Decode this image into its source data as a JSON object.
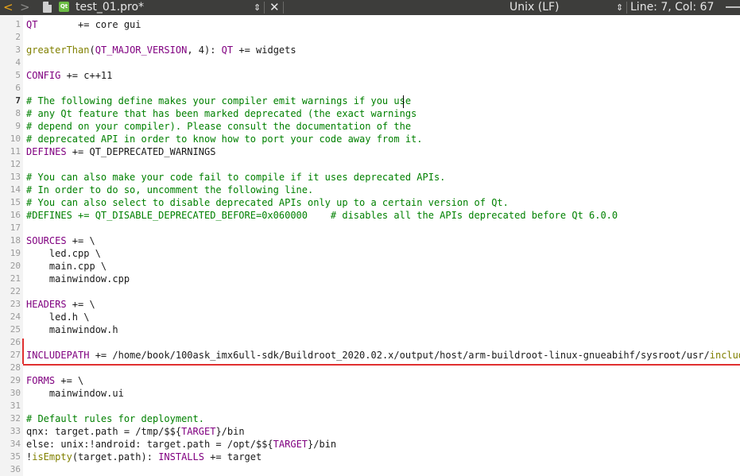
{
  "toolbar": {
    "back_glyph": "<",
    "forward_glyph": ">",
    "file_badge": "Qt",
    "file_name": "test_01.pro*",
    "updown_glyph": "⇕",
    "close_glyph": "✕",
    "line_ending": "Unix (LF)",
    "line_ending_arrow": "⇕",
    "position": "Line: 7, Col: 67"
  },
  "editor": {
    "current_line": 7,
    "lines": [
      [
        {
          "t": "QT",
          "c": "var"
        },
        {
          "t": "       += core gui",
          "c": "plain"
        }
      ],
      [],
      [
        {
          "t": "greaterThan",
          "c": "fn"
        },
        {
          "t": "(",
          "c": "plain"
        },
        {
          "t": "QT_MAJOR_VERSION",
          "c": "var"
        },
        {
          "t": ", 4): ",
          "c": "plain"
        },
        {
          "t": "QT",
          "c": "var"
        },
        {
          "t": " += widgets",
          "c": "plain"
        }
      ],
      [],
      [
        {
          "t": "CONFIG",
          "c": "var"
        },
        {
          "t": " += c++11",
          "c": "plain"
        }
      ],
      [],
      [
        {
          "t": "# The following define makes your compiler emit warnings if you use",
          "c": "cm"
        }
      ],
      [
        {
          "t": "# any Qt feature that has been marked deprecated (the exact warnings",
          "c": "cm"
        }
      ],
      [
        {
          "t": "# depend on your compiler). Please consult the documentation of the",
          "c": "cm"
        }
      ],
      [
        {
          "t": "# deprecated API in order to know how to port your code away from it.",
          "c": "cm"
        }
      ],
      [
        {
          "t": "DEFINES",
          "c": "var"
        },
        {
          "t": " += QT_DEPRECATED_WARNINGS",
          "c": "plain"
        }
      ],
      [],
      [
        {
          "t": "# You can also make your code fail to compile if it uses deprecated APIs.",
          "c": "cm"
        }
      ],
      [
        {
          "t": "# In order to do so, uncomment the following line.",
          "c": "cm"
        }
      ],
      [
        {
          "t": "# You can also select to disable deprecated APIs only up to a certain version of Qt.",
          "c": "cm"
        }
      ],
      [
        {
          "t": "#DEFINES += QT_DISABLE_DEPRECATED_BEFORE=0x060000    # disables all the APIs deprecated before Qt 6.0.0",
          "c": "cm"
        }
      ],
      [],
      [
        {
          "t": "SOURCES",
          "c": "var"
        },
        {
          "t": " += \\",
          "c": "plain"
        }
      ],
      [
        {
          "t": "    led.cpp \\",
          "c": "plain"
        }
      ],
      [
        {
          "t": "    main.cpp \\",
          "c": "plain"
        }
      ],
      [
        {
          "t": "    mainwindow.cpp",
          "c": "plain"
        }
      ],
      [],
      [
        {
          "t": "HEADERS",
          "c": "var"
        },
        {
          "t": " += \\",
          "c": "plain"
        }
      ],
      [
        {
          "t": "    led.h \\",
          "c": "plain"
        }
      ],
      [
        {
          "t": "    mainwindow.h",
          "c": "plain"
        }
      ],
      [],
      [
        {
          "t": "INCLUDEPATH",
          "c": "var"
        },
        {
          "t": " += /home/book/100ask_imx6ull-sdk/Buildroot_2020.02.x/output/host/arm-buildroot-linux-gnueabihf/sysroot/usr/",
          "c": "plain"
        },
        {
          "t": "include",
          "c": "fn"
        }
      ],
      [],
      [
        {
          "t": "FORMS",
          "c": "var"
        },
        {
          "t": " += \\",
          "c": "plain"
        }
      ],
      [
        {
          "t": "    mainwindow.ui",
          "c": "plain"
        }
      ],
      [],
      [
        {
          "t": "# Default rules for deployment.",
          "c": "cm"
        }
      ],
      [
        {
          "t": "qnx: target.path = /tmp/$${",
          "c": "plain"
        },
        {
          "t": "TARGET",
          "c": "var"
        },
        {
          "t": "}/bin",
          "c": "plain"
        }
      ],
      [
        {
          "t": "else: unix:!android: target.path = /opt/$${",
          "c": "plain"
        },
        {
          "t": "TARGET",
          "c": "var"
        },
        {
          "t": "}/bin",
          "c": "plain"
        }
      ],
      [
        {
          "t": "!",
          "c": "plain"
        },
        {
          "t": "isEmpty",
          "c": "fn"
        },
        {
          "t": "(target.path): ",
          "c": "plain"
        },
        {
          "t": "INSTALLS",
          "c": "var"
        },
        {
          "t": " += target",
          "c": "plain"
        }
      ],
      []
    ]
  },
  "colors": {
    "toolbar_bg": "#3d3d3b",
    "back_arrow": "#e8a317",
    "keyword": "#800080",
    "function": "#808000",
    "comment": "#008000",
    "annotation": "#e03030"
  }
}
